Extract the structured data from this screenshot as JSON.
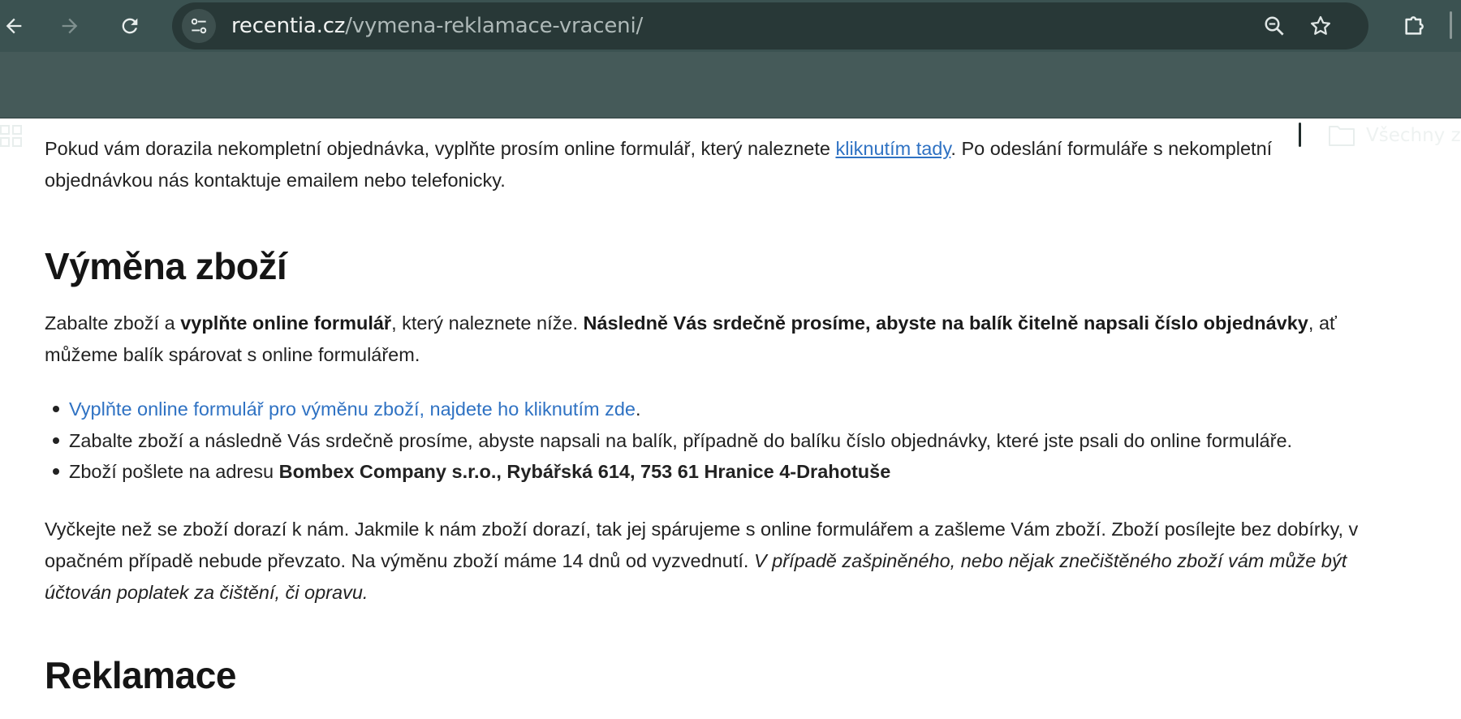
{
  "browser": {
    "url_host": "recentia.cz",
    "url_path": "/vymena-reklamace-vraceni/",
    "bookmark_folder_label": "Všechny za",
    "icons": [
      "back-icon",
      "forward-icon",
      "reload-icon",
      "site-info-icon",
      "zoom-icon",
      "star-icon",
      "extensions-icon",
      "apps-icon",
      "folder-icon"
    ]
  },
  "content": {
    "intro": {
      "text_before": "Pokud vám dorazila nekompletní objednávka, vyplňte prosím online formulář, který naleznete ",
      "link": "kliknutím tady",
      "text_after": ". Po odeslání formuláře s nekompletní",
      "line2": "objednávkou nás kontaktuje emailem nebo telefonicky."
    },
    "exchange": {
      "heading": "Výměna zboží",
      "p1_part1": "Zabalte zboží a ",
      "p1_bold1": "vyplňte online formulář",
      "p1_part2": ", který naleznete níže. ",
      "p1_bold2": "Následně Vás srdečně prosíme, abyste na balík čitelně napsali číslo objednávky",
      "p1_part3": ", ať",
      "p1_line2": "můžeme balík spárovat s online formulářem.",
      "list": {
        "item1_link": "Vyplňte online formulář pro výměnu zboží, najdete ho kliknutím zde",
        "item1_end": ".",
        "item2": "Zabalte zboží a následně Vás srdečně prosíme, abyste napsali na balík, případně do balíku číslo objednávky, které jste psali do online formuláře.",
        "item3_text": "Zboží pošlete na adresu ",
        "item3_bold": "Bombex Company s.r.o., Rybářská 614, 753 61 Hranice 4-Drahotuše"
      },
      "p2_line1": "Vyčkejte než se zboží dorazí k nám. Jakmile k nám zboží dorazí, tak jej spárujeme s online formulářem a zašleme Vám zboží. Zboží posílejte bez dobírky, v",
      "p2_line2_normal": "opačném případě nebude převzato. Na výměnu zboží máme 14 dnů od vyzvednutí. ",
      "p2_line2_italic": "V případě zašpiněného, nebo nějak znečištěného zboží vám může být",
      "p2_line3_italic": "účtován poplatek za čištění, či opravu."
    },
    "complaints": {
      "heading": "Reklamace"
    }
  },
  "colors": {
    "toolbar_bg": "#3b5251",
    "bookmark_bar_bg": "#455a59",
    "omnibox_bg": "#283837",
    "link": "#2f72c3"
  }
}
